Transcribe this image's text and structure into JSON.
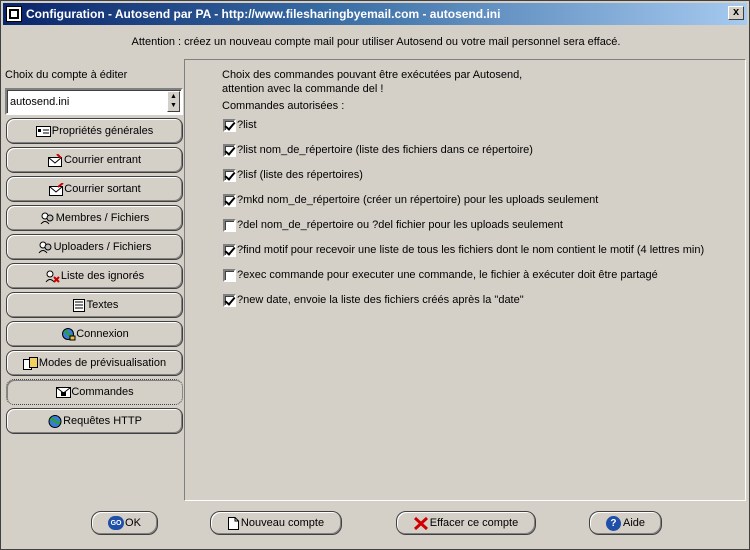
{
  "window": {
    "title": "Configuration - Autosend par PA - http://www.filesharingbyemail.com - autosend.ini",
    "close_label": "x"
  },
  "attention": "Attention : créez un nouveau compte mail pour utiliser Autosend ou votre mail personnel sera effacé.",
  "account": {
    "label": "Choix du compte à éditer",
    "value": "autosend.ini"
  },
  "nav": [
    {
      "label": "Propriétés générales",
      "icon": "properties-icon"
    },
    {
      "label": "Courrier entrant",
      "icon": "mail-in-icon"
    },
    {
      "label": "Courrier sortant",
      "icon": "mail-out-icon"
    },
    {
      "label": "Membres / Fichiers",
      "icon": "members-icon"
    },
    {
      "label": "Uploaders / Fichiers",
      "icon": "uploaders-icon"
    },
    {
      "label": "Liste des ignorés",
      "icon": "ignored-icon"
    },
    {
      "label": "Textes",
      "icon": "text-icon"
    },
    {
      "label": "Connexion",
      "icon": "connection-icon"
    },
    {
      "label": "Modes de prévisualisation",
      "icon": "preview-icon"
    },
    {
      "label": "Commandes",
      "icon": "commands-icon"
    },
    {
      "label": "Requêtes HTTP",
      "icon": "http-icon"
    }
  ],
  "panel": {
    "intro_line1": "Choix des commandes pouvant être exécutées par Autosend,",
    "intro_line2": "attention avec la commande del !",
    "commands_label": "Commandes autorisées :",
    "commands": [
      {
        "text": "?list",
        "checked": true
      },
      {
        "text": "?list nom_de_répertoire (liste des fichiers dans ce répertoire)",
        "checked": true
      },
      {
        "text": "?lisf (liste des répertoires)",
        "checked": true
      },
      {
        "text": "?mkd nom_de_répertoire (créer un répertoire) pour les uploads seulement",
        "checked": true
      },
      {
        "text": "?del nom_de_répertoire ou ?del fichier pour les uploads seulement",
        "checked": false
      },
      {
        "text": "?find motif pour recevoir une liste de tous les fichiers dont le nom contient le motif (4 lettres min)",
        "checked": true
      },
      {
        "text": "?exec commande pour executer une commande, le fichier à exécuter doit être partagé",
        "checked": false
      },
      {
        "text": "?new date, envoie la liste des fichiers créés après la \"date\"",
        "checked": true
      }
    ]
  },
  "buttons": {
    "ok": "OK",
    "ok_icon_text": "GO",
    "new_account": "Nouveau compte",
    "delete_account": "Effacer ce compte",
    "help": "Aide"
  }
}
